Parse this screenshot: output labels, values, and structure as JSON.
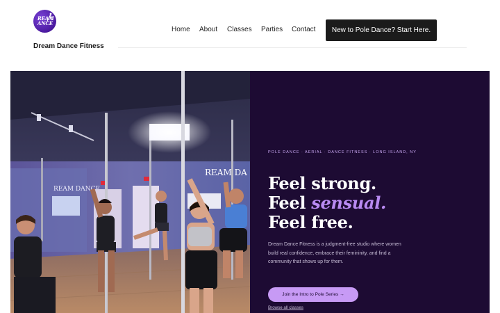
{
  "brand": {
    "name": "Dream Dance Fitness",
    "logo_text": "REAM\nANCE",
    "logo_icon": "dancer-silhouette-icon"
  },
  "nav": {
    "items": [
      {
        "label": "Home"
      },
      {
        "label": "About"
      },
      {
        "label": "Classes"
      },
      {
        "label": "Parties"
      },
      {
        "label": "Contact"
      }
    ],
    "cta_label": "New to Pole Dance? Start Here."
  },
  "hero": {
    "eyebrow": "Pole Dance · Aerial · Dance Fitness · Long Island, NY",
    "headline_line1": "Feel strong.",
    "headline_line2_prefix": "Feel ",
    "headline_line2_accent": "sensual.",
    "headline_line3": "Feel free.",
    "body": "Dream Dance Fitness is a judgment-free studio where women build real confidence, embrace their femininity, and find a community that shows up for them.",
    "primary_button": "Join the Intro to Pole Series →",
    "secondary_link": "Browse all classes",
    "photo_wall_text": "REAM DA"
  },
  "colors": {
    "panel_bg": "#1d0b33",
    "accent_purple": "#b98af2",
    "button_bg": "#c79af5",
    "cta_bg": "#1b1b1b"
  }
}
